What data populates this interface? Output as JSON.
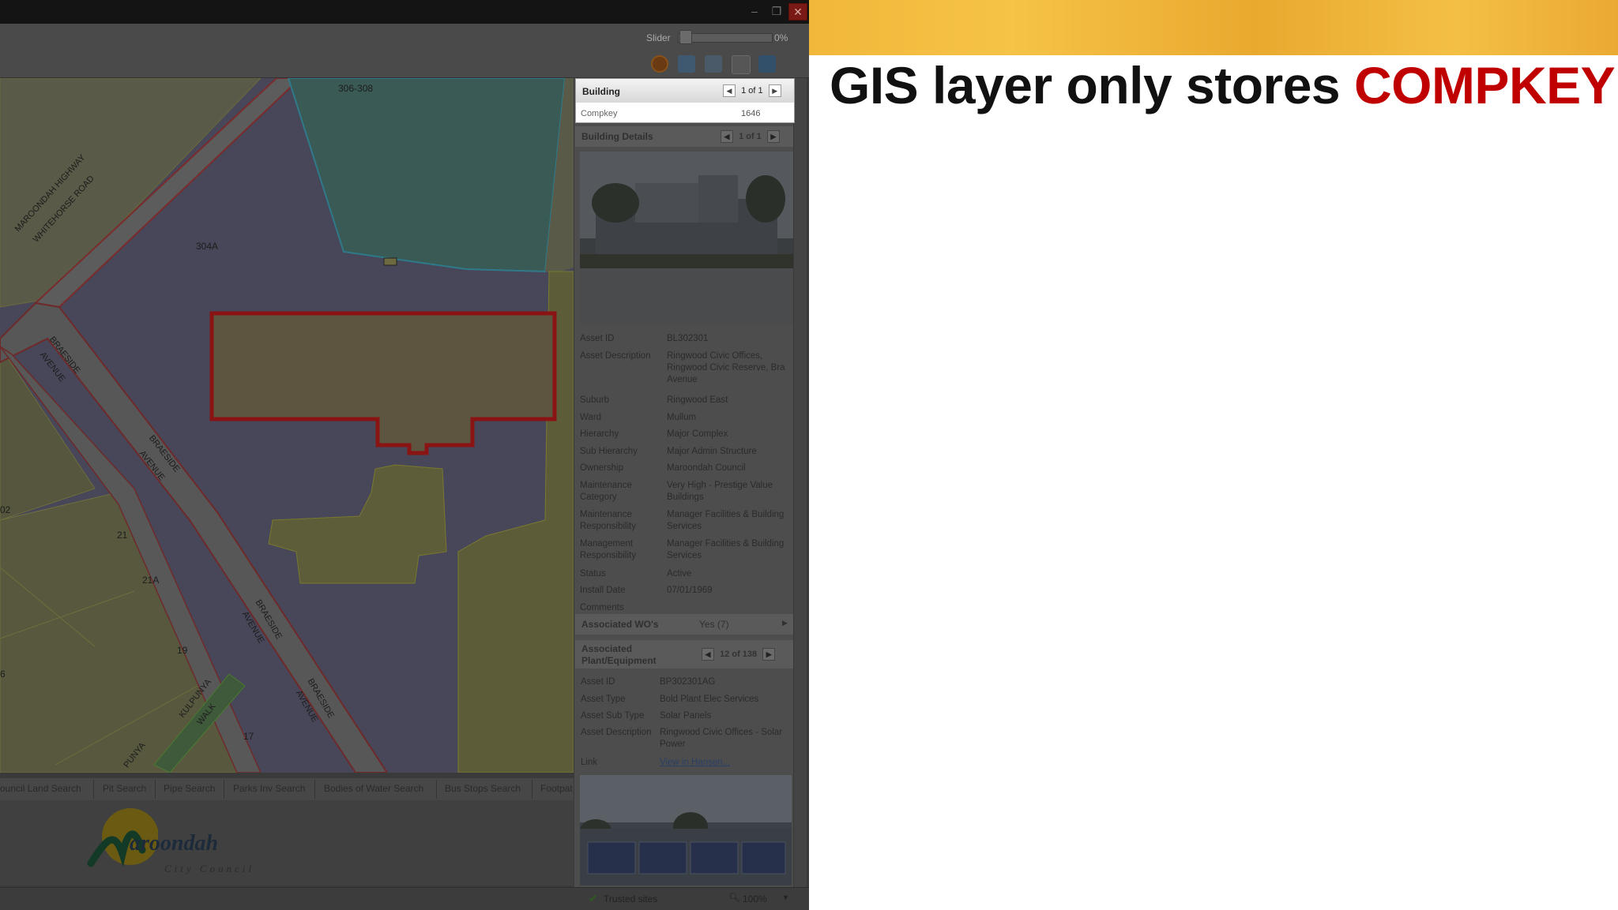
{
  "window": {
    "controls": [
      "–",
      "❐",
      "✕"
    ]
  },
  "toolbar": {
    "slider_label": "Slider",
    "slider_value": "0%",
    "tools": [
      "clear-selection-icon",
      "select-icon",
      "select-deselect-icon",
      "export-excel-icon",
      "table-icon"
    ]
  },
  "map": {
    "labels": {
      "lot_306_308": "306-308",
      "highway": "MAROONDAH HIGHWAY",
      "whitehorse": "WHITEHORSE ROAD",
      "lot_304a": "304A",
      "braeside1": "BRAESIDE",
      "avenue1": "AVENUE",
      "braeside2": "BRAESIDE",
      "avenue2": "AVENUE",
      "braeside3": "BRAESIDE",
      "avenue3": "AVENUE",
      "braeside4": "BRAESIDE",
      "avenue4": "AVENUE",
      "lot_02": "02",
      "lot_21": "21",
      "lot_21a": "21A",
      "lot_19": "19",
      "lot_6": "6",
      "lot_17": "17",
      "kulpunya": "KULPUNYA",
      "walk": "WALK",
      "punya": "PUNYA"
    }
  },
  "building": {
    "title": "Building",
    "nav": "1 of 1",
    "compkey_label": "Compkey",
    "compkey_value": "1646"
  },
  "building_details": {
    "title": "Building Details",
    "nav": "1 of 1",
    "fields": [
      {
        "k": "Asset ID",
        "v": "BL302301"
      },
      {
        "k": "Asset Description",
        "v": "Ringwood Civic Offices, Ringwood Civic Reserve, Bra Avenue"
      },
      {
        "k": "Suburb",
        "v": "Ringwood East"
      },
      {
        "k": "Ward",
        "v": "Mullum"
      },
      {
        "k": "Hierarchy",
        "v": "Major Complex"
      },
      {
        "k": "Sub Hierarchy",
        "v": "Major Admin Structure"
      },
      {
        "k": "Ownership",
        "v": "Maroondah Council"
      },
      {
        "k": "Maintenance Category",
        "v": "Very High - Prestige Value Buildings"
      },
      {
        "k": "Maintenance Responsibility",
        "v": "Manager Facilities & Building Services"
      },
      {
        "k": "Management Responsibility",
        "v": "Manager Facilities & Building Services"
      },
      {
        "k": "Status",
        "v": "Active"
      },
      {
        "k": "Install Date",
        "v": "07/01/1969"
      },
      {
        "k": "Comments",
        "v": ""
      }
    ]
  },
  "associated_wos": {
    "title": "Associated WO's",
    "value": "Yes (7)"
  },
  "plant": {
    "title_line1": "Associated",
    "title_line2": "Plant/Equipment",
    "nav": "12 of 138",
    "fields": [
      {
        "k": "Asset ID",
        "v": "BP302301AG"
      },
      {
        "k": "Asset Type",
        "v": "Bold Plant Elec Services"
      },
      {
        "k": "Asset Sub Type",
        "v": "Solar Panels"
      },
      {
        "k": "Asset Description",
        "v": "Ringwood Civic Offices - Solar Power"
      },
      {
        "k": "Link",
        "v": "View in Hansen..."
      }
    ]
  },
  "bottom_tabs": [
    "ouncil Land Search",
    "Pit Search",
    "Pipe Search",
    "Parks Inv Search",
    "Bodies of Water Search",
    "Bus Stops Search",
    "Footpat"
  ],
  "logo": {
    "word": "aroondah",
    "sub": "City Council"
  },
  "status": {
    "trusted": "Trusted sites",
    "zoom": "100%"
  },
  "slide": {
    "headline_plain": "GIS layer only stores ",
    "headline_accent": "COMPKEY",
    "accent_color": "#c00000"
  }
}
